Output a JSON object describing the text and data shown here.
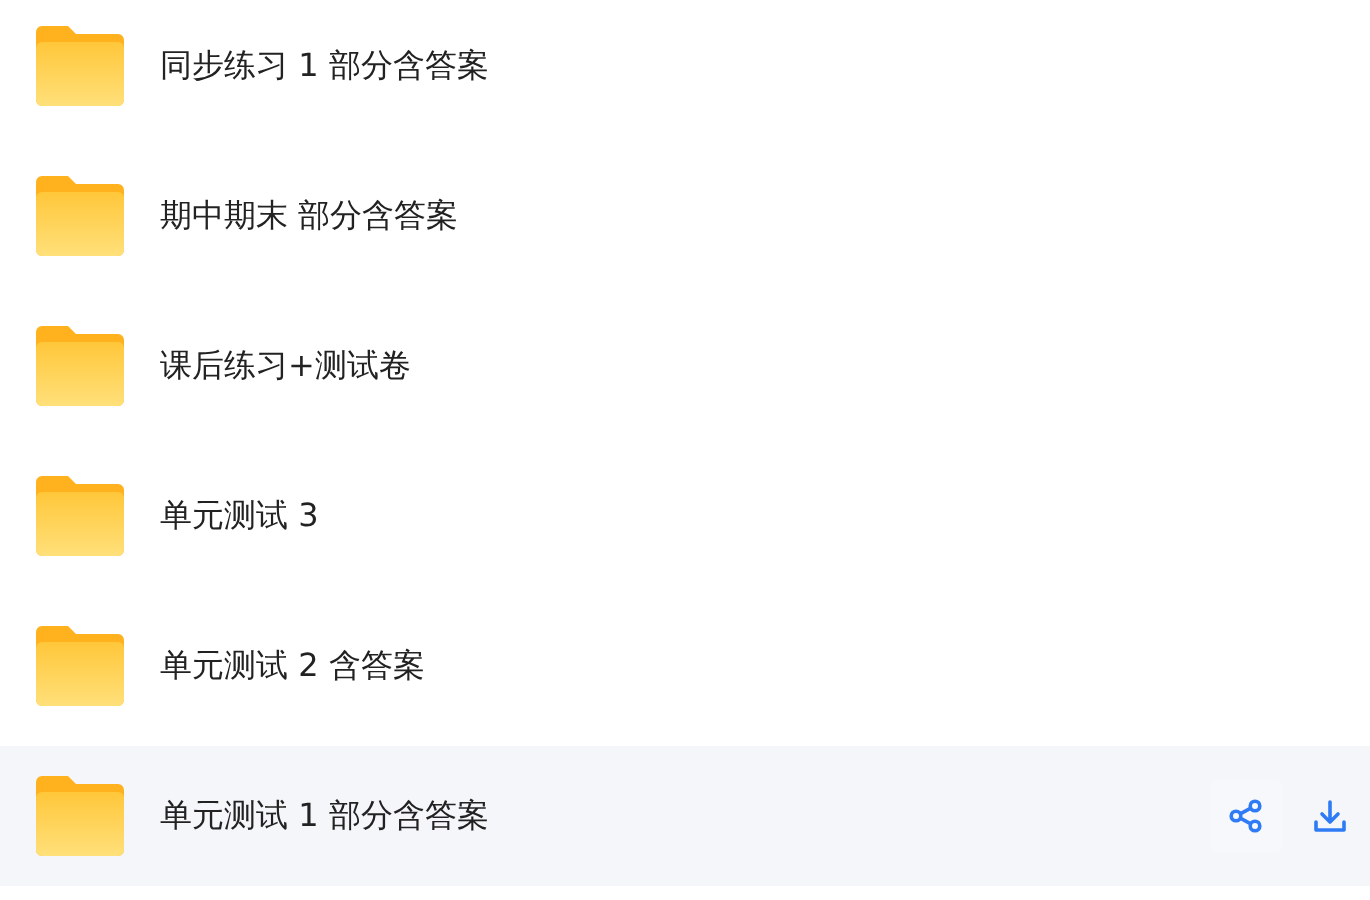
{
  "folders": [
    {
      "name": "同步练习 1 部分含答案",
      "hovered": false
    },
    {
      "name": "期中期末 部分含答案",
      "hovered": false
    },
    {
      "name": "课后练习+测试卷",
      "hovered": false
    },
    {
      "name": "单元测试 3",
      "hovered": false
    },
    {
      "name": "单元测试 2 含答案",
      "hovered": false
    },
    {
      "name": "单元测试 1 部分含答案",
      "hovered": true
    }
  ]
}
